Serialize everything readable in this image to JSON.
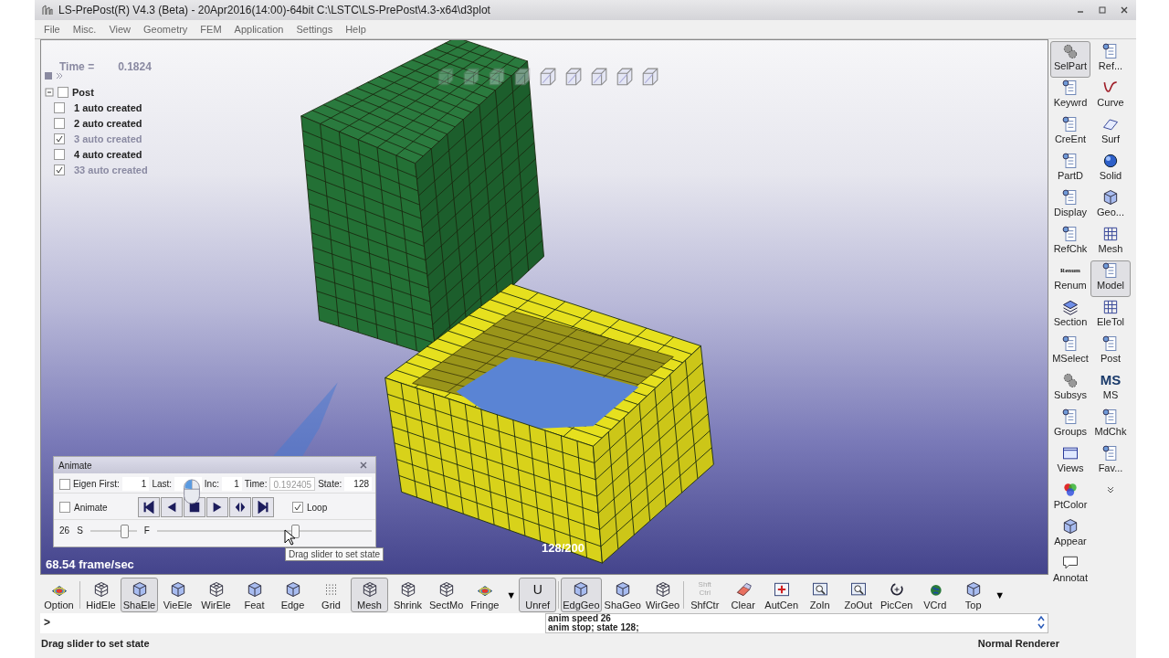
{
  "window": {
    "title": "LS-PrePost(R) V4.3 (Beta) - 20Apr2016(14:00)-64bit C:\\LSTC\\LS-PrePost\\4.3-x64\\d3plot"
  },
  "menu": [
    "File",
    "Misc.",
    "View",
    "Geometry",
    "FEM",
    "Application",
    "Settings",
    "Help"
  ],
  "viewport": {
    "time_label": "Time =",
    "time_value": "0.1824",
    "state_readout": "128/200",
    "frame_rate": "68.54 frame/sec",
    "tree": [
      {
        "label": "Post",
        "checked": false,
        "expanded": true,
        "children": [
          {
            "label": "1 auto created",
            "checked": false
          },
          {
            "label": "2 auto created",
            "checked": false
          },
          {
            "label": "3 auto created",
            "checked": true
          },
          {
            "label": "4 auto created",
            "checked": false
          },
          {
            "label": "33 auto created",
            "checked": true
          }
        ]
      }
    ]
  },
  "animate": {
    "title": "Animate",
    "eigen": {
      "label": "Eigen",
      "checked": false
    },
    "first_label": "First:",
    "first": "1",
    "last_label": "Last:",
    "inc_label": "Inc:",
    "inc": "1",
    "time_label": "Time:",
    "time": "0.192405",
    "state_label": "State:",
    "state": "128",
    "animate_check": {
      "label": "Animate",
      "checked": false
    },
    "loop": {
      "label": "Loop",
      "checked": true
    },
    "speed": "26",
    "slow_label": "S",
    "fast_label": "F",
    "speed_slider": {
      "level": 0.72
    },
    "state_slider": {
      "level": 0.64
    },
    "tooltip": "Drag slider to set state"
  },
  "side_tools": {
    "left": [
      {
        "label": "SelPart",
        "selected": true
      },
      {
        "label": "Keywrd",
        "selected": false
      },
      {
        "label": "CreEnt",
        "selected": false
      },
      {
        "label": "PartD",
        "selected": false
      },
      {
        "label": "Display",
        "selected": false
      },
      {
        "label": "RefChk",
        "selected": false
      },
      {
        "label": "Renum",
        "selected": false,
        "icon_text": "Renum"
      },
      {
        "label": "Section",
        "selected": false
      },
      {
        "label": "MSelect",
        "selected": false
      },
      {
        "label": "Subsys",
        "selected": false
      },
      {
        "label": "Groups",
        "selected": false
      },
      {
        "label": "Views",
        "selected": false
      },
      {
        "label": "PtColor",
        "selected": false
      },
      {
        "label": "Appear",
        "selected": false
      },
      {
        "label": "Annotat",
        "selected": false
      }
    ],
    "right": [
      {
        "label": "Ref...",
        "selected": false
      },
      {
        "label": "Curve",
        "selected": false
      },
      {
        "label": "Surf",
        "selected": false
      },
      {
        "label": "Solid",
        "selected": false
      },
      {
        "label": "Geo...",
        "selected": false
      },
      {
        "label": "Mesh",
        "selected": false
      },
      {
        "label": "Model",
        "selected": true
      },
      {
        "label": "EleTol",
        "selected": false
      },
      {
        "label": "Post",
        "selected": false
      },
      {
        "label": "MS",
        "selected": false,
        "icon_text": "MS"
      },
      {
        "label": "MdChk",
        "selected": false
      },
      {
        "label": "Fav...",
        "selected": false
      }
    ]
  },
  "toolbar": [
    {
      "kind": "tool",
      "label": "Option",
      "selected": false
    },
    {
      "kind": "separator"
    },
    {
      "kind": "tool",
      "label": "HidEle",
      "selected": false
    },
    {
      "kind": "tool",
      "label": "ShaEle",
      "selected": true
    },
    {
      "kind": "tool",
      "label": "VieEle",
      "selected": false
    },
    {
      "kind": "tool",
      "label": "WirEle",
      "selected": false
    },
    {
      "kind": "tool",
      "label": "Feat",
      "selected": false
    },
    {
      "kind": "tool",
      "label": "Edge",
      "selected": false
    },
    {
      "kind": "tool",
      "label": "Grid",
      "selected": false
    },
    {
      "kind": "tool",
      "label": "Mesh",
      "selected": true
    },
    {
      "kind": "tool",
      "label": "Shrink",
      "selected": false
    },
    {
      "kind": "tool",
      "label": "SectMo",
      "selected": false
    },
    {
      "kind": "tool",
      "label": "Fringe",
      "selected": false
    },
    {
      "kind": "arrow",
      "label": "▼"
    },
    {
      "kind": "tool",
      "label": "Unref",
      "selected": true,
      "icon_text": "U"
    },
    {
      "kind": "separator"
    },
    {
      "kind": "tool",
      "label": "EdgGeo",
      "selected": true
    },
    {
      "kind": "tool",
      "label": "ShaGeo",
      "selected": false
    },
    {
      "kind": "tool",
      "label": "WirGeo",
      "selected": false
    },
    {
      "kind": "separator"
    },
    {
      "kind": "tool",
      "label": "ShfCtr",
      "selected": false,
      "icon_text": "Shft Ctrl"
    },
    {
      "kind": "tool",
      "label": "Clear",
      "selected": false
    },
    {
      "kind": "tool",
      "label": "AutCen",
      "selected": false
    },
    {
      "kind": "tool",
      "label": "ZoIn",
      "selected": false
    },
    {
      "kind": "tool",
      "label": "ZoOut",
      "selected": false
    },
    {
      "kind": "tool",
      "label": "PicCen",
      "selected": false
    },
    {
      "kind": "tool",
      "label": "VCrd",
      "selected": false
    },
    {
      "kind": "tool",
      "label": "Top",
      "selected": false
    },
    {
      "kind": "arrow",
      "label": "▼"
    }
  ],
  "command": {
    "prompt": ">",
    "log": [
      "anim speed 26",
      "anim stop; state 128;"
    ]
  },
  "status_bar": {
    "message": "Drag slider to set state",
    "renderer": "Normal Renderer"
  }
}
